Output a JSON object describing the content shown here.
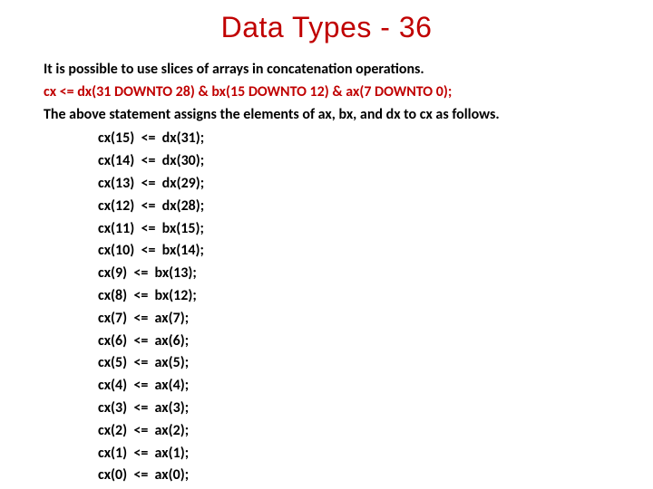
{
  "title": "Data Types - 36",
  "intro": "It is possible to use slices of arrays  in concatenation operations.",
  "code": "cx  <= dx(31 DOWNTO 28)  &  bx(15 DOWNTO 12)  & ax(7 DOWNTO 0);",
  "explanation": "The above statement assigns the elements of ax, bx, and dx to cx as follows.",
  "assignments": [
    "cx(15)  <=  dx(31);",
    "cx(14)  <=  dx(30);",
    "cx(13)  <=  dx(29);",
    "cx(12)  <=  dx(28);",
    "cx(11)  <=  bx(15);",
    "cx(10)  <=  bx(14);",
    "cx(9)  <=  bx(13);",
    "cx(8)  <=  bx(12);",
    "cx(7)  <=  ax(7);",
    "cx(6)  <=  ax(6);",
    "cx(5)  <=  ax(5);",
    "cx(4)  <=  ax(4);",
    "cx(3)  <=  ax(3);",
    "cx(2)  <=  ax(2);",
    "cx(1)  <=  ax(1);",
    "cx(0)  <=  ax(0);"
  ]
}
